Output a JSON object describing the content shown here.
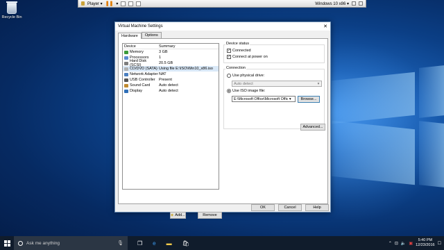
{
  "desktop": {
    "recycle_bin_label": "Recycle Bin"
  },
  "vm_toolbar": {
    "player_label": "Player ▾",
    "vm_name": "Windows 10 x86 ▾"
  },
  "dialog": {
    "title": "Virtual Machine Settings",
    "close_glyph": "✕",
    "tabs": [
      {
        "label": "Hardware",
        "active": true
      },
      {
        "label": "Options",
        "active": false
      }
    ],
    "device_table": {
      "headers": [
        "Device",
        "Summary"
      ],
      "rows": [
        {
          "device": "Memory",
          "summary": "3 GB",
          "icon_color": "#3b9b3b",
          "icon": "memory-icon"
        },
        {
          "device": "Processors",
          "summary": "1",
          "icon_color": "#5b8bd0",
          "icon": "processor-icon"
        },
        {
          "device": "Hard Disk (SCSI)",
          "summary": "20.5 GB",
          "icon_color": "#7d7d7d",
          "icon": "hard-disk-icon"
        },
        {
          "device": "CD/DVD (SATA)",
          "summary": "Using file E:\\ISO\\Win10_x86.iso",
          "icon_color": "#b0b0b0",
          "icon": "cd-dvd-icon",
          "selected": true
        },
        {
          "device": "Network Adapter",
          "summary": "NAT",
          "icon_color": "#4a7fc0",
          "icon": "network-adapter-icon"
        },
        {
          "device": "USB Controller",
          "summary": "Present",
          "icon_color": "#555555",
          "icon": "usb-icon"
        },
        {
          "device": "Sound Card",
          "summary": "Auto detect",
          "icon_color": "#c08a30",
          "icon": "speaker-icon"
        },
        {
          "device": "Display",
          "summary": "Auto detect",
          "icon_color": "#2f6fb8",
          "icon": "display-icon"
        }
      ]
    },
    "add_button": "Add...",
    "remove_button": "Remove",
    "device_status": {
      "title": "Device status",
      "connected": {
        "label": "Connected",
        "checked": true
      },
      "connect_power_on": {
        "label": "Connect at power on",
        "checked": true
      }
    },
    "connection": {
      "title": "Connection",
      "physical_drive_label": "Use physical drive:",
      "physical_drive_value": "Auto detect",
      "iso_label": "Use ISO image file:",
      "iso_value": "E:\\Microsoft Office\\Microsoft Offic ▾",
      "selected": "iso",
      "browse_button": "Browse..."
    },
    "advanced_button": "Advanced...",
    "footer": {
      "ok": "OK",
      "cancel": "Cancel",
      "help": "Help"
    }
  },
  "taskbar": {
    "search_placeholder": "Ask me anything",
    "time": "5:40 PM",
    "date": "12/23/2016"
  },
  "colors": {
    "desktop_dark": "#062a62",
    "desktop_light": "#3b8ee8",
    "taskbar": "#101c2c",
    "dialog_bg": "#f0f0f0",
    "selection": "#d9e8f7"
  }
}
